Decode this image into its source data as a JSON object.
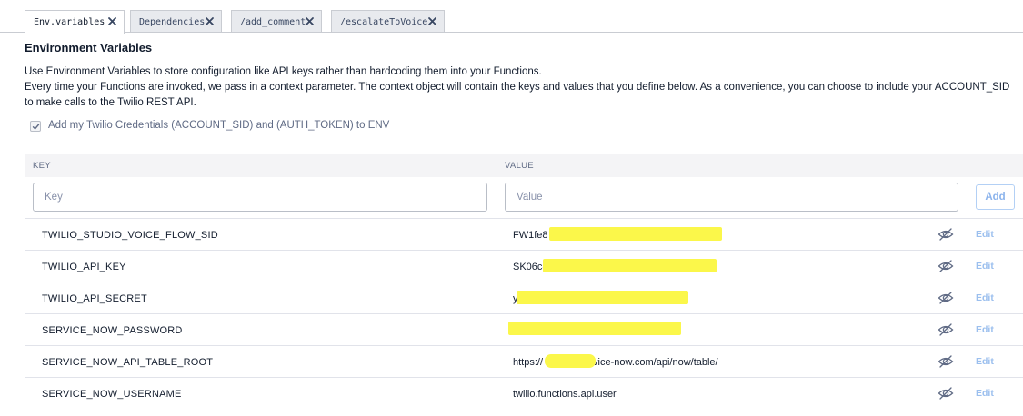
{
  "tabs": [
    {
      "label": "Env.variables",
      "active": true
    },
    {
      "label": "Dependencies",
      "active": false
    },
    {
      "label": "/add_comment",
      "active": false
    },
    {
      "label": "/escalateToVoice",
      "active": false
    }
  ],
  "page": {
    "title": "Environment Variables",
    "desc_line1": "Use Environment Variables to store configuration like API keys rather than hardcoding them into your Functions.",
    "desc_line2": "Every time your Functions are invoked, we pass in a context parameter. The context object will contain the keys and values that you define below. As a convenience, you can choose to include your ACCOUNT_SID",
    "desc_line3": "to make calls to the Twilio REST API.",
    "checkbox_label": "Add my Twilio Credentials (ACCOUNT_SID) and (AUTH_TOKEN) to ENV",
    "checkbox_checked": true
  },
  "table": {
    "col_key": "KEY",
    "col_value": "VALUE",
    "key_placeholder": "Key",
    "value_placeholder": "Value",
    "add_label": "Add",
    "edit_label": "Edit",
    "rows": [
      {
        "key": "TWILIO_STUDIO_VOICE_FLOW_SID",
        "value": "FW1fe8"
      },
      {
        "key": "TWILIO_API_KEY",
        "value": "SK06c8"
      },
      {
        "key": "TWILIO_API_SECRET",
        "value": "y"
      },
      {
        "key": "SERVICE_NOW_PASSWORD",
        "value": ""
      },
      {
        "key": "SERVICE_NOW_API_TABLE_ROOT",
        "value": "https://            .service-now.com/api/now/table/"
      },
      {
        "key": "SERVICE_NOW_USERNAME",
        "value": "twilio.functions.api.user"
      }
    ]
  },
  "colors": {
    "redaction": "#fbf74a",
    "edit_link": "#9bbfee",
    "border": "#c9ccd2"
  },
  "icons": {
    "tab_close": "close-icon",
    "row_visibility": "eye-slash-icon",
    "checkbox": "check-icon"
  }
}
